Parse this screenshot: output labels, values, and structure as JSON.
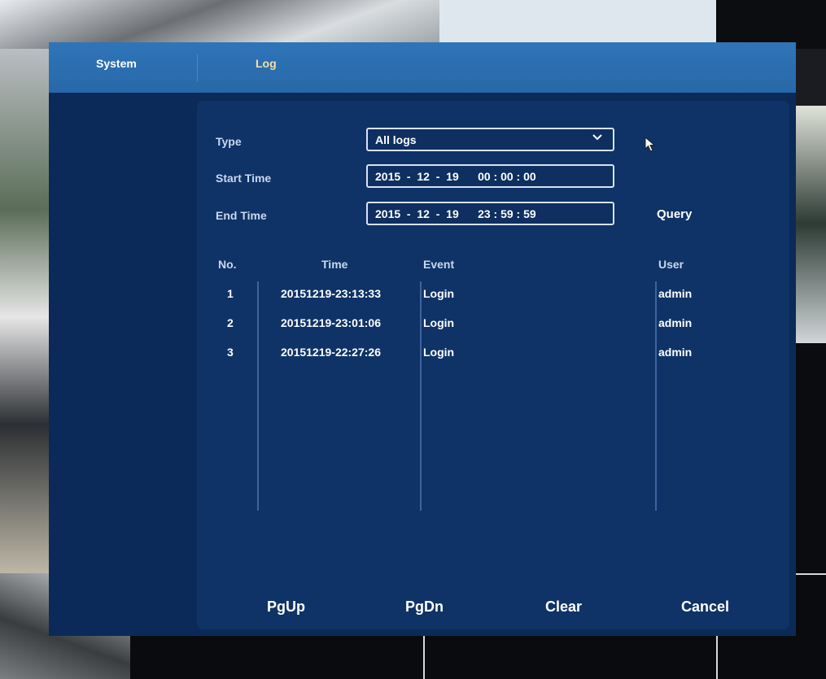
{
  "tabs": {
    "system": "System",
    "log": "Log"
  },
  "filters": {
    "type_label": "Type",
    "type_value": "All logs",
    "start_label": "Start Time",
    "start_value": "2015  -  12  -  19      00 : 00 : 00",
    "end_label": "End Time",
    "end_value": "2015  -  12  -  19      23 : 59 : 59",
    "query": "Query"
  },
  "table": {
    "headers": {
      "no": "No.",
      "time": "Time",
      "event": "Event",
      "user": "User"
    },
    "rows": [
      {
        "no": "1",
        "time": "20151219-23:13:33",
        "event": "Login",
        "user": "admin"
      },
      {
        "no": "2",
        "time": "20151219-23:01:06",
        "event": "Login",
        "user": "admin"
      },
      {
        "no": "3",
        "time": "20151219-22:27:26",
        "event": "Login",
        "user": "admin"
      }
    ]
  },
  "buttons": {
    "pgup": "PgUp",
    "pgdn": "PgDn",
    "clear": "Clear",
    "cancel": "Cancel"
  },
  "icons": {
    "dropdown": "chevron-down-icon",
    "cursor": "mouse-pointer-icon"
  },
  "colors": {
    "header": "#2f75b8",
    "panel": "#0f3366",
    "background": "#0c2a58",
    "active_tab": "#f2e0a8"
  }
}
